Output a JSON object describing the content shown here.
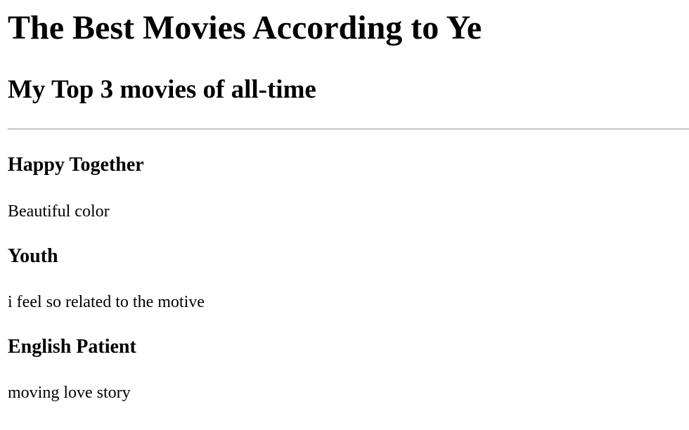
{
  "page": {
    "title": "The Best Movies According to Ye",
    "subtitle": "My Top 3 movies of all-time"
  },
  "movies": [
    {
      "title": "Happy Together",
      "description": "Beautiful color"
    },
    {
      "title": "Youth",
      "description": "i feel so related to the motive"
    },
    {
      "title": "English Patient",
      "description": "moving love story"
    }
  ]
}
